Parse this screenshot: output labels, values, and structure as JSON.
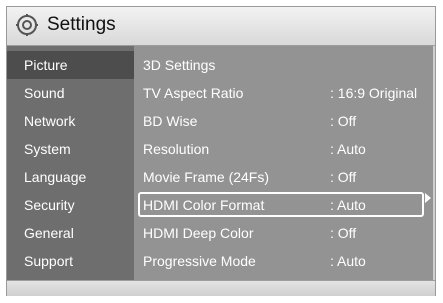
{
  "window": {
    "title": "Settings"
  },
  "sidebar": {
    "items": [
      {
        "label": "Picture",
        "active": true
      },
      {
        "label": "Sound"
      },
      {
        "label": "Network"
      },
      {
        "label": "System"
      },
      {
        "label": "Language"
      },
      {
        "label": "Security"
      },
      {
        "label": "General"
      },
      {
        "label": "Support"
      }
    ]
  },
  "settings": {
    "rows": [
      {
        "label": "3D Settings",
        "value": ""
      },
      {
        "label": "TV Aspect Ratio",
        "value": ": 16:9 Original"
      },
      {
        "label": "BD Wise",
        "value": ": Off"
      },
      {
        "label": "Resolution",
        "value": ": Auto"
      },
      {
        "label": "Movie Frame (24Fs)",
        "value": ": Off"
      },
      {
        "label": "HDMI Color Format",
        "value": ": Auto",
        "selected": true
      },
      {
        "label": "HDMI Deep Color",
        "value": ": Off"
      },
      {
        "label": "Progressive Mode",
        "value": ": Auto"
      }
    ]
  },
  "icons": {
    "title": "gear-icon",
    "more": "chevron-right-icon"
  },
  "colors": {
    "sidebar": "#6e6e6e",
    "content": "#939393",
    "active": "#4d4d4d",
    "text": "#ffffff"
  }
}
